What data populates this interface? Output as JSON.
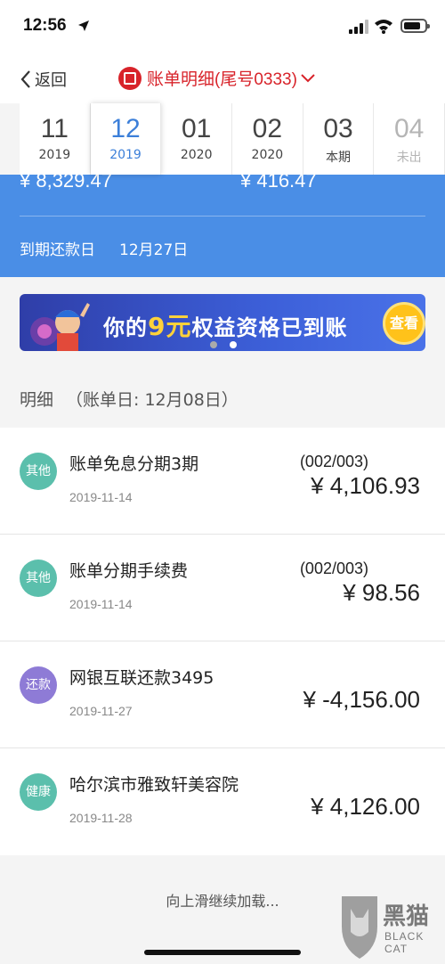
{
  "status_bar": {
    "time": "12:56"
  },
  "nav": {
    "back_label": "返回",
    "title": "账单明细(尾号0333)"
  },
  "month_tabs": [
    {
      "num": "11",
      "sub": "2019"
    },
    {
      "num": "12",
      "sub": "2019"
    },
    {
      "num": "01",
      "sub": "2020"
    },
    {
      "num": "02",
      "sub": "2020"
    },
    {
      "num": "03",
      "sub": "本期"
    },
    {
      "num": "04",
      "sub": "未出"
    }
  ],
  "summary": {
    "amount_left": "¥ 8,329.47",
    "amount_right": "¥ 416.47",
    "due_label": "到期还款日",
    "due_date": "12月27日"
  },
  "banner": {
    "text_pre": "你的",
    "text_highlight": "9元",
    "text_post": "权益资格已到账",
    "button": "查看"
  },
  "detail": {
    "label": "明细",
    "bill_day": "（账单日: 12月08日）"
  },
  "transactions": [
    {
      "badge": "其他",
      "badge_color": "#5bbfac",
      "name": "账单免息分期3期",
      "installment": "(002/003)",
      "date": "2019-11-14",
      "amount": "¥ 4,106.93"
    },
    {
      "badge": "其他",
      "badge_color": "#5bbfac",
      "name": "账单分期手续费",
      "installment": "(002/003)",
      "date": "2019-11-14",
      "amount": "¥ 98.56"
    },
    {
      "badge": "还款",
      "badge_color": "#8e7bd6",
      "name": "网银互联还款3495",
      "installment": "",
      "date": "2019-11-27",
      "amount": "¥ -4,156.00"
    },
    {
      "badge": "健康",
      "badge_color": "#5bbfac",
      "name": "哈尔滨市雅致轩美容院",
      "installment": "",
      "date": "2019-11-28",
      "amount": "¥ 4,126.00"
    }
  ],
  "load_more": "向上滑继续加载...",
  "watermark": {
    "text": "黑猫",
    "sub": "BLACK CAT"
  },
  "colors": {
    "accent": "#3c7fd9",
    "brand_red": "#d8232a",
    "summary_blue": "#4a8ee6"
  }
}
